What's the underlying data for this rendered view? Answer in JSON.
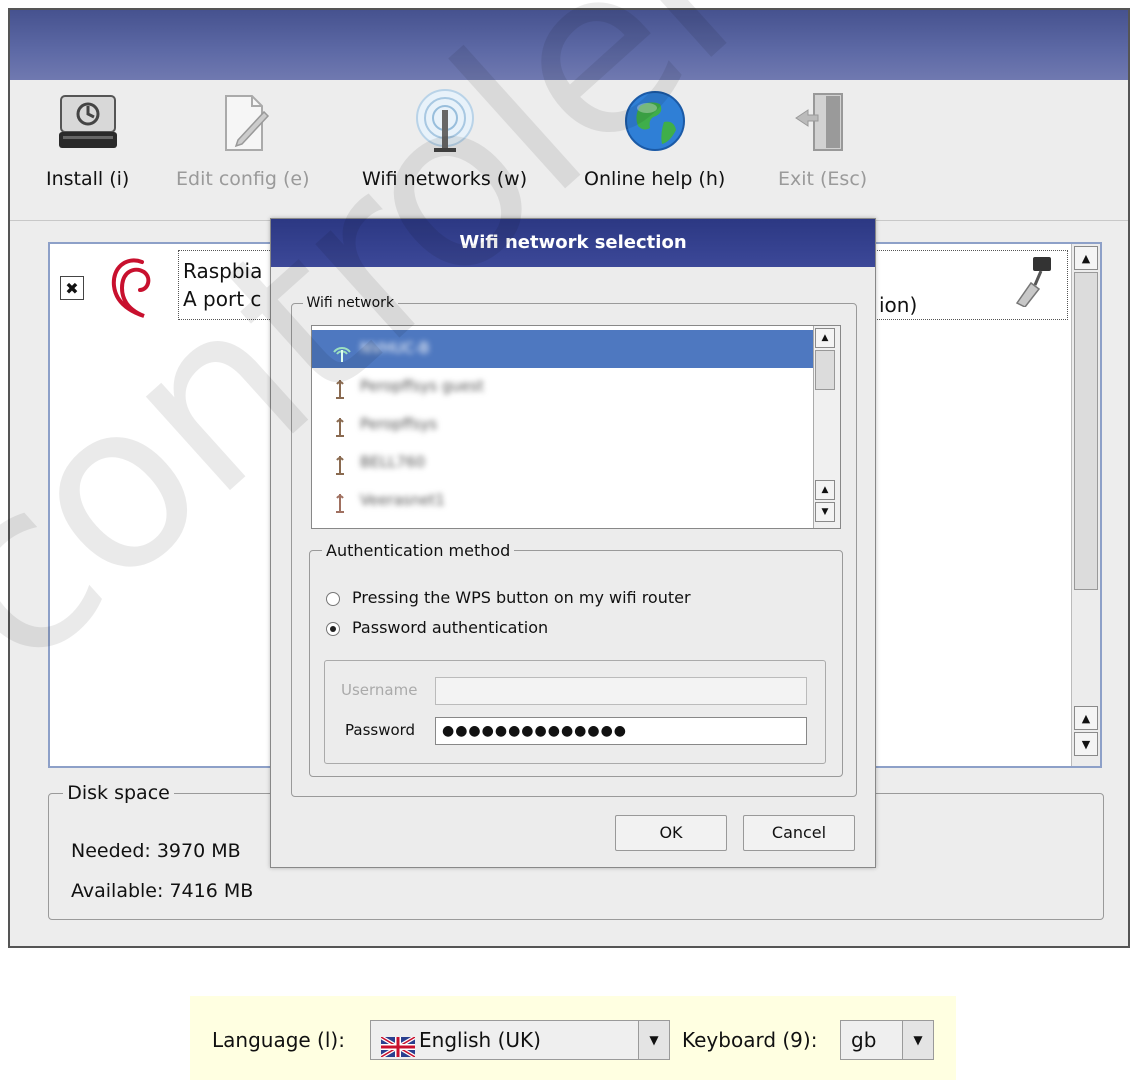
{
  "toolbar": {
    "install_label": "Install (i)",
    "edit_config_label": "Edit config (e)",
    "wifi_label": "Wifi networks (w)",
    "help_label": "Online help (h)",
    "exit_label": "Exit (Esc)"
  },
  "os_list": {
    "item_name": "Raspbia",
    "item_desc": "A port c",
    "item_desc_tail": "ion)",
    "checked_mark": "✖"
  },
  "disk_space": {
    "legend": "Disk space",
    "needed": "Needed: 3970 MB",
    "available": "Available: 7416 MB"
  },
  "dialog": {
    "title": "Wifi network selection",
    "network_group_label": "Wifi network",
    "networks": [
      {
        "name": "NVHUC-B"
      },
      {
        "name": "Peropffsys guest"
      },
      {
        "name": "Peropffsys"
      },
      {
        "name": "BELL760"
      },
      {
        "name": "Veerasnet1"
      }
    ],
    "auth_group_label": "Authentication method",
    "option_wps": "Pressing the WPS button on my wifi router",
    "option_password": "Password authentication",
    "username_label": "Username",
    "username_value": "",
    "password_label": "Password",
    "password_value": "●●●●●●●●●●●●●●",
    "ok_label": "OK",
    "cancel_label": "Cancel"
  },
  "footer": {
    "language_label": "Language (l):",
    "language_value": "English (UK)",
    "keyboard_label": "Keyboard (9):",
    "keyboard_value": "gb"
  },
  "watermark": "controlengineers",
  "colors": {
    "title_bar": "#5260a0",
    "dialog_title": "#2f3a86",
    "selection": "#4e78c0",
    "footer_bg": "#ffffe1"
  }
}
